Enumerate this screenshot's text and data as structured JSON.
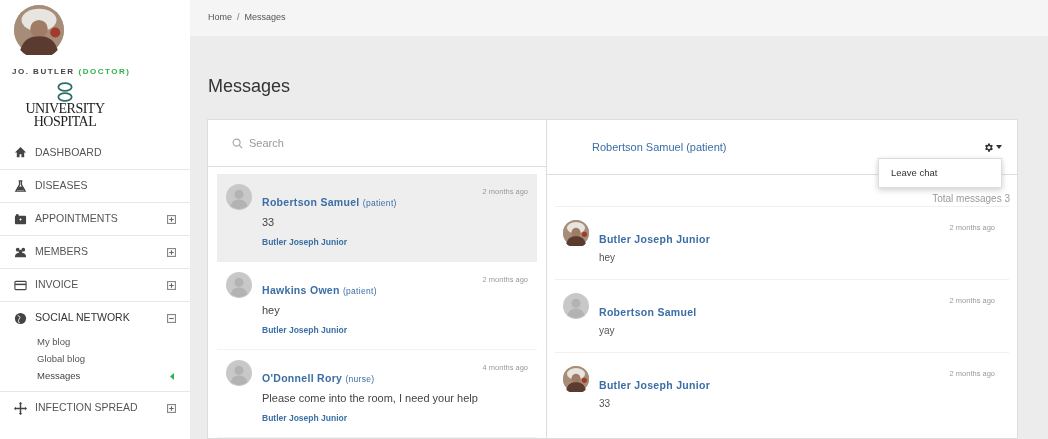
{
  "profile": {
    "name": "JO. BUTLER",
    "role": "(DOCTOR)",
    "logo_text": "UNIVERSITY HOSPITAL"
  },
  "nav": [
    {
      "label": "DASHBOARD",
      "kind": "link"
    },
    {
      "label": "DISEASES",
      "kind": "link"
    },
    {
      "label": "APPOINTMENTS",
      "kind": "group",
      "expanded": false
    },
    {
      "label": "MEMBERS",
      "kind": "group",
      "expanded": false
    },
    {
      "label": "INVOICE",
      "kind": "group",
      "expanded": false
    },
    {
      "label": "SOCIAL NETWORK",
      "kind": "group",
      "expanded": true,
      "children": [
        {
          "label": "My blog",
          "selected": false
        },
        {
          "label": "Global blog",
          "selected": false
        },
        {
          "label": "Messages",
          "selected": true
        }
      ]
    },
    {
      "label": "INFECTION SPREAD",
      "kind": "group",
      "expanded": false
    }
  ],
  "breadcrumb": {
    "items": [
      "Home",
      "Messages"
    ],
    "separator": "/"
  },
  "page_title": "Messages",
  "search": {
    "placeholder": "Search"
  },
  "conversations": [
    {
      "name": "Robertson Samuel",
      "role": "(patient)",
      "text": "33",
      "sender": "Butler Joseph Junior",
      "time": "2 months ago",
      "selected": true
    },
    {
      "name": "Hawkins Owen",
      "role": "(patient)",
      "text": "hey",
      "sender": "Butler Joseph Junior",
      "time": "2 months ago",
      "selected": false
    },
    {
      "name": "O'Donnell Rory",
      "role": "(nurse)",
      "text": "Please come into the room, I need your help",
      "sender": "Butler Joseph Junior",
      "time": "4 months ago",
      "selected": false
    }
  ],
  "chat": {
    "title": "Robertson Samuel (patient)",
    "menu": {
      "open": true,
      "items": [
        "Leave chat"
      ]
    },
    "total": "Total messages 3",
    "messages": [
      {
        "name": "Butler Joseph Junior",
        "text": "hey",
        "time": "2 months ago"
      },
      {
        "name": "Robertson Samuel",
        "text": "yay",
        "time": "2 months ago",
        "kind": "placeholder"
      },
      {
        "name": "Butler Joseph Junior",
        "text": "33",
        "time": "2 months ago"
      }
    ]
  }
}
